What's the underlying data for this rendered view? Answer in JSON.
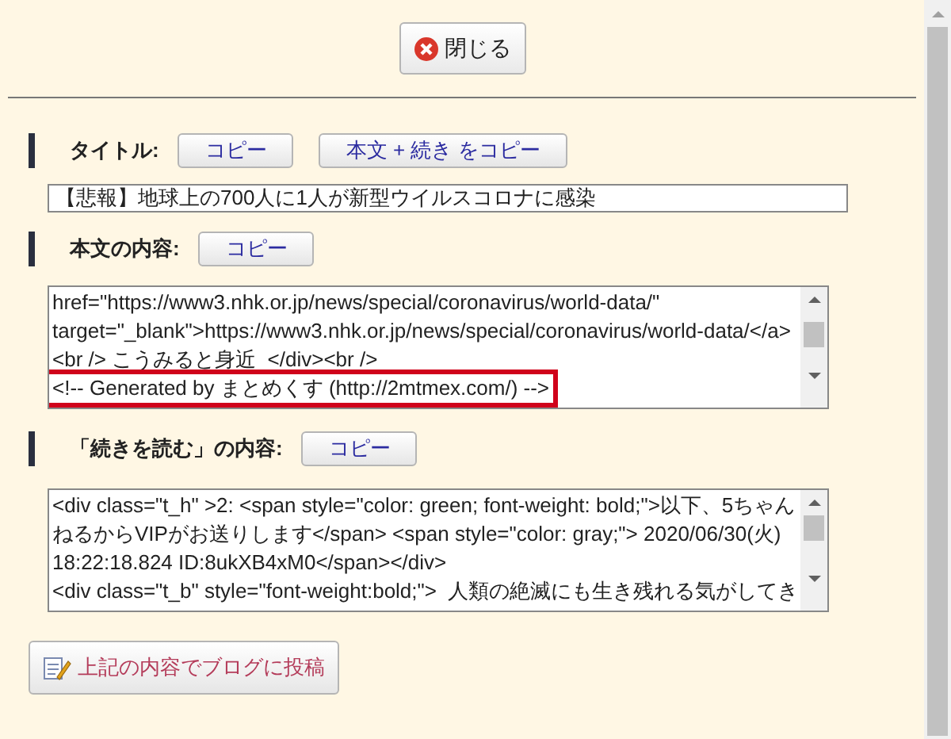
{
  "close_button": {
    "label": "閉じる"
  },
  "title_section": {
    "label": "タイトル:",
    "buttons": [
      "コピー",
      "本文 + 続き をコピー"
    ],
    "field": {
      "value": "【悲報】地球上の700人に1人が新型ウイルスコロナに感染"
    }
  },
  "body_section": {
    "label": "本文の内容:",
    "buttons": [
      "コピー"
    ],
    "textarea": {
      "lines": [
        {
          "text": "href=\"https://www3.nhk.or.jp/news/special/coronavirus/world-data/\"",
          "highlighted": false
        },
        {
          "text": "target=\"_blank\">https://www3.nhk.or.jp/news/special/coronavirus/world-data/</a>",
          "highlighted": false
        },
        {
          "text": "<br /> こうみると身近  </div><br />",
          "highlighted": false
        },
        {
          "text": "<!-- Generated by まとめくす (http://2mtmex.com/) -->",
          "highlighted": true
        }
      ]
    }
  },
  "more_section": {
    "label": "「続きを読む」の内容:",
    "buttons": [
      "コピー"
    ],
    "textarea": {
      "lines": [
        {
          "text": "<div class=\"t_h\" >2: <span style=\"color: green; font-weight: bold;\">以下、5ちゃん",
          "highlighted": false
        },
        {
          "text": "ねるからVIPがお送りします</span> <span style=\"color: gray;\"> 2020/06/30(火)",
          "highlighted": false
        },
        {
          "text": "18:22:18.824 ID:8ukXB4xM0</span></div>",
          "highlighted": false
        },
        {
          "text": "<div class=\"t_b\" style=\"font-weight:bold;\">  人類の絶滅にも生き残れる気がしてき",
          "highlighted": false
        }
      ]
    }
  },
  "post_button": {
    "label": "上記の内容でブログに投稿"
  }
}
